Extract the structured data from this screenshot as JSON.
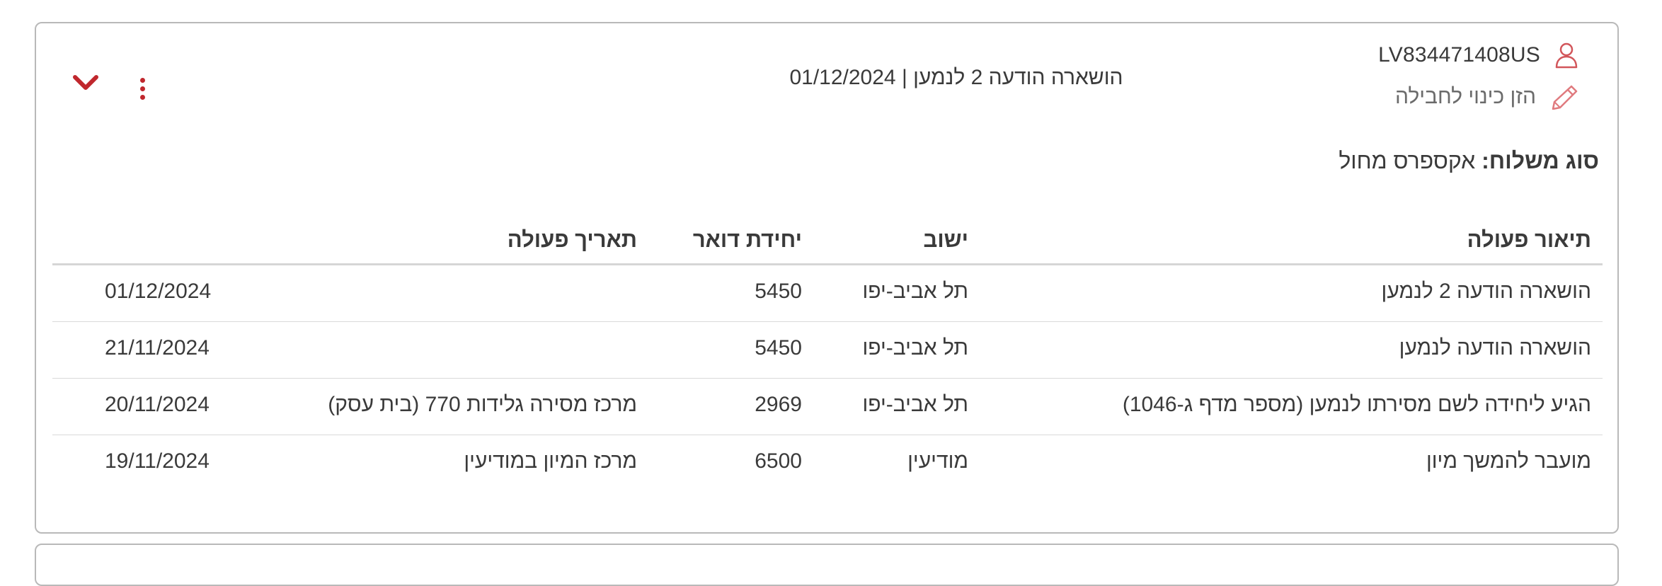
{
  "item": {
    "tracking_number": "LV834471408US",
    "nickname_placeholder": "הזן כינוי לחבילה",
    "last_status": "הושארה הודעה 2 לנמען | 01/12/2024",
    "shipment_type_label": "סוג משלוח:",
    "shipment_type_value": "אקספרס מחול"
  },
  "table": {
    "headers": {
      "description": "תיאור פעולה",
      "city": "ישוב",
      "postal_unit": "יחידת דואר",
      "date": "תאריך פעולה"
    },
    "rows": [
      {
        "description": "הושארה הודעה 2 לנמען",
        "city": "תל אביב-יפו",
        "unit_code": "5450",
        "branch": "",
        "date": "01/12/2024"
      },
      {
        "description": "הושארה הודעה לנמען",
        "city": "תל אביב-יפו",
        "unit_code": "5450",
        "branch": "",
        "date": "21/11/2024"
      },
      {
        "description": "הגיע ליחידה לשם מסירתו לנמען (מספר מדף ג-1046)",
        "city": "תל אביב-יפו",
        "unit_code": "2969",
        "branch": "מרכז מסירה גלידות 770 (בית עסק)",
        "date": "20/11/2024"
      },
      {
        "description": "מועבר להמשך מיון",
        "city": "מודיעין",
        "unit_code": "6500",
        "branch": "מרכז המיון במודיעין",
        "date": "19/11/2024"
      }
    ]
  },
  "icons": {
    "user": "user-icon",
    "pencil": "pencil-icon",
    "kebab": "more-vertical-icon",
    "chevron": "chevron-down-icon"
  },
  "colors": {
    "accent": "#c0272d",
    "border": "#b9b9b9",
    "text": "#3a3a3a",
    "muted": "#6b6b6b"
  }
}
